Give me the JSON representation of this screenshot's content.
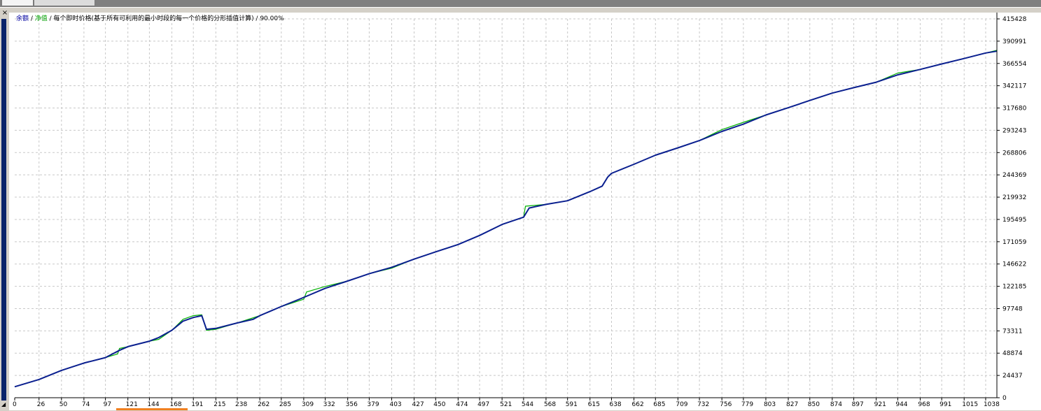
{
  "window": {
    "close_icon": "close-icon",
    "tabs": [
      "",
      ""
    ]
  },
  "legend": {
    "balance_label": "余额",
    "separator": " / ",
    "equity_label": "净值",
    "description": " / 每个即时价格(基于所有可利用的最小时段的每一个价格的分形插值计算) / 90.00%"
  },
  "colors": {
    "balance": "#0a1f8f",
    "equity": "#00b000",
    "grid": "#c8c8c8",
    "background": "#ffffff",
    "axis_text": "#000000"
  },
  "chart_data": {
    "type": "line",
    "title": "",
    "xlabel": "",
    "ylabel": "",
    "xlim": [
      0,
      1050
    ],
    "ylim": [
      0,
      415428
    ],
    "grid": true,
    "x_ticks": [
      0,
      26,
      50,
      74,
      97,
      121,
      144,
      168,
      191,
      215,
      238,
      262,
      285,
      309,
      332,
      356,
      379,
      403,
      427,
      450,
      474,
      497,
      521,
      544,
      568,
      591,
      615,
      638,
      662,
      685,
      709,
      732,
      756,
      779,
      803,
      827,
      850,
      874,
      897,
      921,
      944,
      968,
      991,
      1015,
      1038
    ],
    "y_ticks": [
      0,
      24437,
      48874,
      73311,
      97748,
      122185,
      146622,
      171059,
      195495,
      219932,
      244369,
      268806,
      293243,
      317680,
      342117,
      366554,
      390991,
      415428
    ],
    "series": [
      {
        "name": "余额",
        "color": "#0a1f8f",
        "points": [
          [
            0,
            12000
          ],
          [
            26,
            20000
          ],
          [
            50,
            30000
          ],
          [
            74,
            38000
          ],
          [
            97,
            44000
          ],
          [
            112,
            52000
          ],
          [
            121,
            56000
          ],
          [
            144,
            62000
          ],
          [
            154,
            66000
          ],
          [
            168,
            74000
          ],
          [
            180,
            84000
          ],
          [
            191,
            88000
          ],
          [
            200,
            90000
          ],
          [
            205,
            75000
          ],
          [
            215,
            76000
          ],
          [
            238,
            82000
          ],
          [
            255,
            86000
          ],
          [
            262,
            90000
          ],
          [
            285,
            100000
          ],
          [
            309,
            110000
          ],
          [
            332,
            120000
          ],
          [
            356,
            128000
          ],
          [
            379,
            136000
          ],
          [
            403,
            143000
          ],
          [
            427,
            152000
          ],
          [
            450,
            160000
          ],
          [
            474,
            168000
          ],
          [
            497,
            178000
          ],
          [
            521,
            190000
          ],
          [
            544,
            198000
          ],
          [
            550,
            208000
          ],
          [
            568,
            212000
          ],
          [
            591,
            216000
          ],
          [
            615,
            226000
          ],
          [
            628,
            232000
          ],
          [
            634,
            242000
          ],
          [
            638,
            246000
          ],
          [
            662,
            256000
          ],
          [
            685,
            266000
          ],
          [
            709,
            274000
          ],
          [
            732,
            282000
          ],
          [
            756,
            292000
          ],
          [
            779,
            300000
          ],
          [
            803,
            310000
          ],
          [
            827,
            318000
          ],
          [
            850,
            326000
          ],
          [
            874,
            334000
          ],
          [
            897,
            340000
          ],
          [
            921,
            346000
          ],
          [
            944,
            354000
          ],
          [
            968,
            360000
          ],
          [
            991,
            366000
          ],
          [
            1015,
            372000
          ],
          [
            1038,
            378000
          ],
          [
            1050,
            380000
          ]
        ]
      },
      {
        "name": "净值",
        "color": "#00b000",
        "points": [
          [
            0,
            12000
          ],
          [
            26,
            20000
          ],
          [
            50,
            30000
          ],
          [
            74,
            38000
          ],
          [
            97,
            44000
          ],
          [
            110,
            48000
          ],
          [
            112,
            54000
          ],
          [
            121,
            56000
          ],
          [
            144,
            62000
          ],
          [
            154,
            64000
          ],
          [
            168,
            74000
          ],
          [
            180,
            86000
          ],
          [
            191,
            90000
          ],
          [
            200,
            91000
          ],
          [
            205,
            74000
          ],
          [
            215,
            75000
          ],
          [
            238,
            82000
          ],
          [
            262,
            90000
          ],
          [
            285,
            100000
          ],
          [
            309,
            108000
          ],
          [
            312,
            116000
          ],
          [
            332,
            122000
          ],
          [
            356,
            128000
          ],
          [
            379,
            136000
          ],
          [
            403,
            142000
          ],
          [
            427,
            152000
          ],
          [
            450,
            160000
          ],
          [
            474,
            168000
          ],
          [
            497,
            178000
          ],
          [
            521,
            190000
          ],
          [
            544,
            198000
          ],
          [
            546,
            210000
          ],
          [
            568,
            212000
          ],
          [
            591,
            216000
          ],
          [
            615,
            226000
          ],
          [
            628,
            232000
          ],
          [
            634,
            242000
          ],
          [
            638,
            246000
          ],
          [
            662,
            256000
          ],
          [
            685,
            266000
          ],
          [
            709,
            274000
          ],
          [
            732,
            282000
          ],
          [
            756,
            294000
          ],
          [
            779,
            302000
          ],
          [
            803,
            310000
          ],
          [
            827,
            318000
          ],
          [
            850,
            326000
          ],
          [
            874,
            334000
          ],
          [
            897,
            340000
          ],
          [
            921,
            346000
          ],
          [
            944,
            356000
          ],
          [
            968,
            360000
          ],
          [
            991,
            366000
          ],
          [
            1015,
            372000
          ],
          [
            1038,
            378000
          ],
          [
            1050,
            381000
          ]
        ]
      }
    ]
  }
}
